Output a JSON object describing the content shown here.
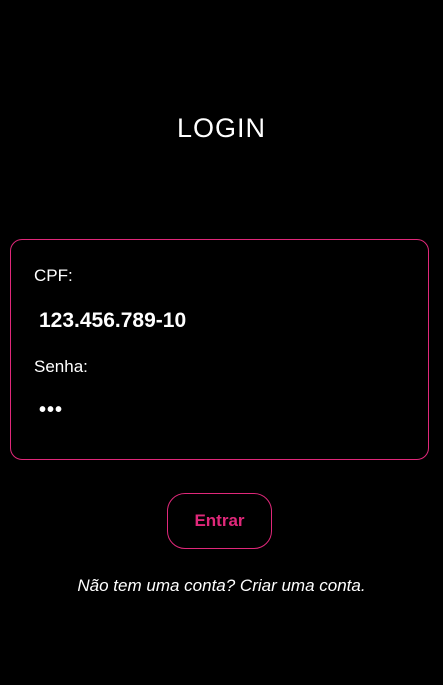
{
  "title": "LOGIN",
  "form": {
    "cpf_label": "CPF:",
    "cpf_value": "123.456.789-10",
    "password_label": "Senha:",
    "password_masked": "•••"
  },
  "submit_label": "Entrar",
  "footer": {
    "prompt": "Não tem uma conta? ",
    "link": "Criar uma conta."
  },
  "colors": {
    "background": "#000000",
    "accent": "#e0287a",
    "text": "#ffffff"
  }
}
